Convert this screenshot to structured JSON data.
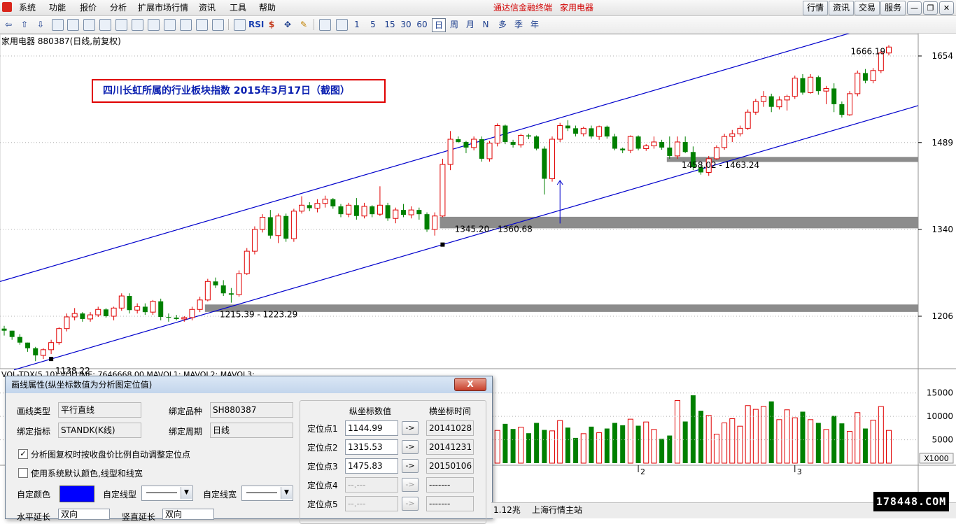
{
  "menu": {
    "items": [
      "系统",
      "功能",
      "报价",
      "分析",
      "扩展市场行情",
      "资讯",
      "工具",
      "帮助"
    ],
    "brand": "通达信金融终端",
    "sector": "家用电器",
    "right_buttons": [
      "行情",
      "资讯",
      "交易",
      "服务"
    ]
  },
  "toolbar": {
    "periods": [
      "1",
      "5",
      "15",
      "30",
      "60",
      "日",
      "周",
      "月",
      "N",
      "多",
      "季",
      "年"
    ],
    "selected_period": "日"
  },
  "chart_header": "家用电器 880387(日线,前复权)",
  "annotation": "四川长虹所属的行业板块指数 2015年3月17日（截图）",
  "chart_data": [
    {
      "type": "candlestick",
      "yscale": "log",
      "ylim": [
        1125,
        1700
      ],
      "yticks": [
        1654,
        1489,
        1340,
        1206
      ],
      "color_up": "#e00000",
      "color_down": "#008000",
      "ohlc": [
        [
          1188,
          1192,
          1178,
          1185
        ],
        [
          1185,
          1185,
          1172,
          1176
        ],
        [
          1176,
          1180,
          1165,
          1168
        ],
        [
          1168,
          1168,
          1155,
          1160
        ],
        [
          1160,
          1162,
          1142,
          1150
        ],
        [
          1150,
          1160,
          1145,
          1158
        ],
        [
          1158,
          1172,
          1152,
          1168
        ],
        [
          1168,
          1190,
          1165,
          1188
        ],
        [
          1188,
          1210,
          1184,
          1205
        ],
        [
          1205,
          1218,
          1200,
          1210
        ],
        [
          1210,
          1212,
          1198,
          1202
        ],
        [
          1202,
          1212,
          1198,
          1208
        ],
        [
          1208,
          1220,
          1205,
          1216
        ],
        [
          1216,
          1218,
          1204,
          1206
        ],
        [
          1206,
          1220,
          1200,
          1218
        ],
        [
          1218,
          1240,
          1214,
          1236
        ],
        [
          1236,
          1240,
          1210,
          1215
        ],
        [
          1215,
          1225,
          1210,
          1220
        ],
        [
          1220,
          1225,
          1208,
          1212
        ],
        [
          1212,
          1230,
          1208,
          1228
        ],
        [
          1228,
          1232,
          1200,
          1205
        ],
        [
          1205,
          1210,
          1198,
          1204
        ],
        [
          1204,
          1208,
          1200,
          1202
        ],
        [
          1202,
          1206,
          1198,
          1204
        ],
        [
          1204,
          1220,
          1200,
          1216
        ],
        [
          1216,
          1235,
          1212,
          1230
        ],
        [
          1230,
          1262,
          1228,
          1258
        ],
        [
          1258,
          1264,
          1248,
          1252
        ],
        [
          1252,
          1260,
          1236,
          1240
        ],
        [
          1240,
          1248,
          1226,
          1238
        ],
        [
          1238,
          1275,
          1235,
          1270
        ],
        [
          1270,
          1310,
          1268,
          1305
        ],
        [
          1305,
          1345,
          1300,
          1340
        ],
        [
          1340,
          1365,
          1335,
          1360
        ],
        [
          1360,
          1372,
          1325,
          1330
        ],
        [
          1330,
          1366,
          1318,
          1362
        ],
        [
          1362,
          1366,
          1320,
          1325
        ],
        [
          1325,
          1374,
          1320,
          1370
        ],
        [
          1370,
          1395,
          1366,
          1380
        ],
        [
          1380,
          1385,
          1370,
          1375
        ],
        [
          1375,
          1390,
          1368,
          1383
        ],
        [
          1383,
          1396,
          1376,
          1390
        ],
        [
          1390,
          1392,
          1374,
          1378
        ],
        [
          1378,
          1382,
          1360,
          1365
        ],
        [
          1365,
          1384,
          1360,
          1380
        ],
        [
          1380,
          1392,
          1356,
          1362
        ],
        [
          1362,
          1384,
          1358,
          1378
        ],
        [
          1378,
          1380,
          1360,
          1365
        ],
        [
          1365,
          1412,
          1362,
          1380
        ],
        [
          1380,
          1384,
          1354,
          1358
        ],
        [
          1358,
          1376,
          1350,
          1372
        ],
        [
          1372,
          1382,
          1360,
          1364
        ],
        [
          1364,
          1378,
          1358,
          1372
        ],
        [
          1372,
          1376,
          1356,
          1365
        ],
        [
          1365,
          1368,
          1336,
          1340
        ],
        [
          1340,
          1368,
          1330,
          1362
        ],
        [
          1362,
          1460,
          1360,
          1450
        ],
        [
          1450,
          1510,
          1440,
          1495
        ],
        [
          1495,
          1500,
          1488,
          1490
        ],
        [
          1490,
          1492,
          1470,
          1480
        ],
        [
          1480,
          1500,
          1475,
          1495
        ],
        [
          1495,
          1500,
          1455,
          1460
        ],
        [
          1460,
          1492,
          1455,
          1488
        ],
        [
          1488,
          1524,
          1482,
          1520
        ],
        [
          1520,
          1522,
          1486,
          1490
        ],
        [
          1490,
          1494,
          1480,
          1485
        ],
        [
          1485,
          1505,
          1480,
          1502
        ],
        [
          1502,
          1505,
          1495,
          1500
        ],
        [
          1500,
          1502,
          1475,
          1478
        ],
        [
          1478,
          1482,
          1398,
          1425
        ],
        [
          1425,
          1500,
          1420,
          1495
        ],
        [
          1495,
          1525,
          1490,
          1520
        ],
        [
          1520,
          1530,
          1510,
          1515
        ],
        [
          1515,
          1520,
          1500,
          1505
        ],
        [
          1505,
          1518,
          1500,
          1515
        ],
        [
          1515,
          1520,
          1496,
          1500
        ],
        [
          1500,
          1520,
          1494,
          1518
        ],
        [
          1518,
          1520,
          1496,
          1500
        ],
        [
          1500,
          1505,
          1475,
          1478
        ],
        [
          1478,
          1480,
          1470,
          1475
        ],
        [
          1475,
          1502,
          1470,
          1500
        ],
        [
          1500,
          1502,
          1475,
          1478
        ],
        [
          1478,
          1486,
          1474,
          1483
        ],
        [
          1483,
          1500,
          1478,
          1490
        ],
        [
          1490,
          1494,
          1476,
          1480
        ],
        [
          1480,
          1500,
          1460,
          1465
        ],
        [
          1465,
          1500,
          1460,
          1490
        ],
        [
          1490,
          1500,
          1470,
          1472
        ],
        [
          1472,
          1482,
          1440,
          1445
        ],
        [
          1445,
          1450,
          1432,
          1436
        ],
        [
          1436,
          1465,
          1430,
          1460
        ],
        [
          1460,
          1484,
          1458,
          1480
        ],
        [
          1480,
          1505,
          1476,
          1500
        ],
        [
          1500,
          1512,
          1490,
          1505
        ],
        [
          1505,
          1520,
          1500,
          1515
        ],
        [
          1515,
          1550,
          1512,
          1545
        ],
        [
          1545,
          1570,
          1540,
          1565
        ],
        [
          1565,
          1585,
          1555,
          1575
        ],
        [
          1575,
          1580,
          1545,
          1555
        ],
        [
          1555,
          1575,
          1550,
          1568
        ],
        [
          1568,
          1578,
          1548,
          1575
        ],
        [
          1575,
          1615,
          1570,
          1610
        ],
        [
          1610,
          1618,
          1578,
          1582
        ],
        [
          1582,
          1618,
          1580,
          1612
        ],
        [
          1612,
          1615,
          1578,
          1585
        ],
        [
          1585,
          1595,
          1560,
          1590
        ],
        [
          1590,
          1600,
          1545,
          1560
        ],
        [
          1560,
          1565,
          1535,
          1540
        ],
        [
          1540,
          1585,
          1538,
          1580
        ],
        [
          1580,
          1625,
          1575,
          1620
        ],
        [
          1620,
          1628,
          1600,
          1605
        ],
        [
          1605,
          1630,
          1600,
          1625
        ],
        [
          1625,
          1666,
          1620,
          1660
        ],
        [
          1660,
          1676,
          1655,
          1672
        ]
      ],
      "annotations": [
        {
          "text": "1666.19",
          "index": 114,
          "value": 1666.19
        },
        {
          "text": "1138.22",
          "index": 6,
          "value": 1138.22
        },
        {
          "text": "1345.20 - 1360.68",
          "index": 57,
          "value": 1352
        },
        {
          "text": "1215.39 - 1223.29",
          "index": 27,
          "value": 1219
        },
        {
          "text": "1458.02 - 1463.24",
          "index": 86,
          "value": 1461
        }
      ],
      "channel": {
        "points": [
          {
            "date": "20141028",
            "value": 1144.99
          },
          {
            "date": "20141231",
            "value": 1315.53
          },
          {
            "date": "20150106",
            "value": 1475.83
          }
        ],
        "color": "#0000cc"
      },
      "bands": [
        {
          "from_index": 26,
          "low": 1215.39,
          "high": 1223.29
        },
        {
          "from_index": 56,
          "low": 1345.2,
          "high": 1360.68
        },
        {
          "from_index": 85,
          "low": 1458.02,
          "high": 1463.24
        }
      ]
    },
    {
      "type": "bar",
      "ylim": [
        0,
        17500
      ],
      "yticks": [
        15000,
        10000,
        5000
      ],
      "unit": "X1000",
      "x_labels": [
        "2",
        "3"
      ],
      "x_label_index": [
        81,
        101
      ],
      "values": [
        7500,
        7200,
        7800,
        6900,
        8100,
        7600,
        8300,
        7000,
        6600,
        7300,
        9600,
        8200,
        7200,
        10800,
        9300,
        8100,
        7500,
        8800,
        6200,
        10500,
        7800,
        8900,
        6800,
        7000,
        8400,
        7300,
        7700,
        6400,
        8600,
        7100,
        6900,
        9100,
        7600,
        5400,
        6300,
        7800,
        6500,
        7400,
        8600,
        8100,
        9400,
        8000,
        8800,
        7200,
        5200,
        5900,
        13400,
        8900,
        14500,
        11200,
        10200,
        6200,
        8600,
        9500,
        7900,
        12300,
        11500,
        12100,
        13200,
        9300,
        11400,
        9700,
        11000,
        9300,
        8600,
        7200,
        10100,
        8500,
        6800,
        10800,
        7400,
        9200,
        12100,
        7000
      ],
      "color_up": "#e00000",
      "color_down": "#008000"
    }
  ],
  "vol_header": "VOL-TDX(5,10) VOLUME: 7646668.00  MAVOL1:  MAVOL2:  MAVOL3:",
  "dialog": {
    "title": "画线属性(纵坐标数值为分析图定位值)",
    "close_label": "X",
    "line_type_label": "画线类型",
    "line_type_value": "平行直线",
    "bind_stock_label": "绑定品种",
    "bind_stock_value": "SH880387",
    "bind_indicator_label": "绑定指标",
    "bind_indicator_value": "STANDK(K线)",
    "bind_period_label": "绑定周期",
    "bind_period_value": "日线",
    "auto_adjust_label": "分析图复权时按收盘价比例自动调整定位点",
    "auto_adjust_checked": "✓",
    "use_default_label": "使用系统默认颜色,线型和线宽",
    "custom_color_label": "自定颜色",
    "custom_color": "#0000ff",
    "custom_linetype_label": "自定线型",
    "custom_linewidth_label": "自定线宽",
    "col_value": "纵坐标数值",
    "col_time": "横坐标时间",
    "anchors": [
      {
        "label": "定位点1",
        "value": "1144.99",
        "time": "20141028"
      },
      {
        "label": "定位点2",
        "value": "1315.53",
        "time": "20141231"
      },
      {
        "label": "定位点3",
        "value": "1475.83",
        "time": "20150106"
      },
      {
        "label": "定位点4",
        "value": "--.---",
        "time": "-------"
      },
      {
        "label": "定位点5",
        "value": "--.---",
        "time": "-------"
      }
    ],
    "arrow_label": "->",
    "h_extend_label": "水平延长",
    "h_extend_value": "双向",
    "v_extend_label": "竖直延长",
    "v_extend_value": "双向"
  },
  "status": {
    "amount": "1.12兆",
    "station": "上海行情主站"
  },
  "watermark": "178448.COM"
}
